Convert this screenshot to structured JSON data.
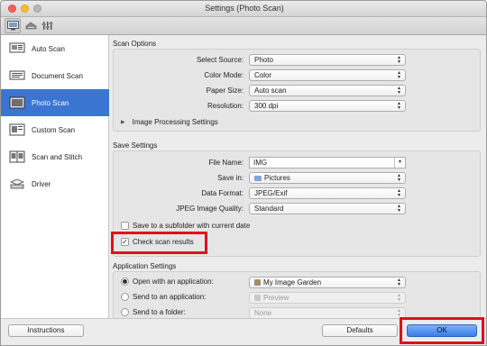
{
  "window": {
    "title": "Settings (Photo Scan)"
  },
  "toolbar": {
    "buttons": [
      "scan-from-computer-icon",
      "scan-from-panel-icon",
      "general-settings-icon"
    ]
  },
  "sidebar": {
    "items": [
      {
        "label": "Auto Scan",
        "icon": "auto-scan-icon",
        "active": false
      },
      {
        "label": "Document Scan",
        "icon": "document-scan-icon",
        "active": false
      },
      {
        "label": "Photo Scan",
        "icon": "photo-scan-icon",
        "active": true
      },
      {
        "label": "Custom Scan",
        "icon": "custom-scan-icon",
        "active": false
      },
      {
        "label": "Scan and Stitch",
        "icon": "scan-and-stitch-icon",
        "active": false
      },
      {
        "label": "Driver",
        "icon": "driver-icon",
        "active": false
      }
    ]
  },
  "scan_options": {
    "title": "Scan Options",
    "select_source": {
      "label": "Select Source:",
      "value": "Photo"
    },
    "color_mode": {
      "label": "Color Mode:",
      "value": "Color"
    },
    "paper_size": {
      "label": "Paper Size:",
      "value": "Auto scan"
    },
    "resolution": {
      "label": "Resolution:",
      "value": "300 dpi"
    },
    "image_processing": "Image Processing Settings"
  },
  "save_settings": {
    "title": "Save Settings",
    "file_name": {
      "label": "File Name:",
      "value": "IMG"
    },
    "save_in": {
      "label": "Save in:",
      "value": "Pictures"
    },
    "data_format": {
      "label": "Data Format:",
      "value": "JPEG/Exif"
    },
    "jpeg_quality": {
      "label": "JPEG Image Quality:",
      "value": "Standard"
    },
    "save_subfolder": {
      "label": "Save to a subfolder with current date",
      "checked": false
    },
    "check_scan_results": {
      "label": "Check scan results",
      "checked": true
    }
  },
  "application_settings": {
    "title": "Application Settings",
    "open_with": {
      "label": "Open with an application:",
      "value": "My Image Garden",
      "selected": true
    },
    "send_to_app": {
      "label": "Send to an application:",
      "value": "Preview",
      "selected": false
    },
    "send_to_folder": {
      "label": "Send to a folder:",
      "value": "None",
      "selected": false
    }
  },
  "footer": {
    "instructions_label": "Instructions",
    "defaults_label": "Defaults",
    "ok_label": "OK"
  },
  "colors": {
    "accent": "#3b75d2",
    "highlight": "#e0101e"
  }
}
